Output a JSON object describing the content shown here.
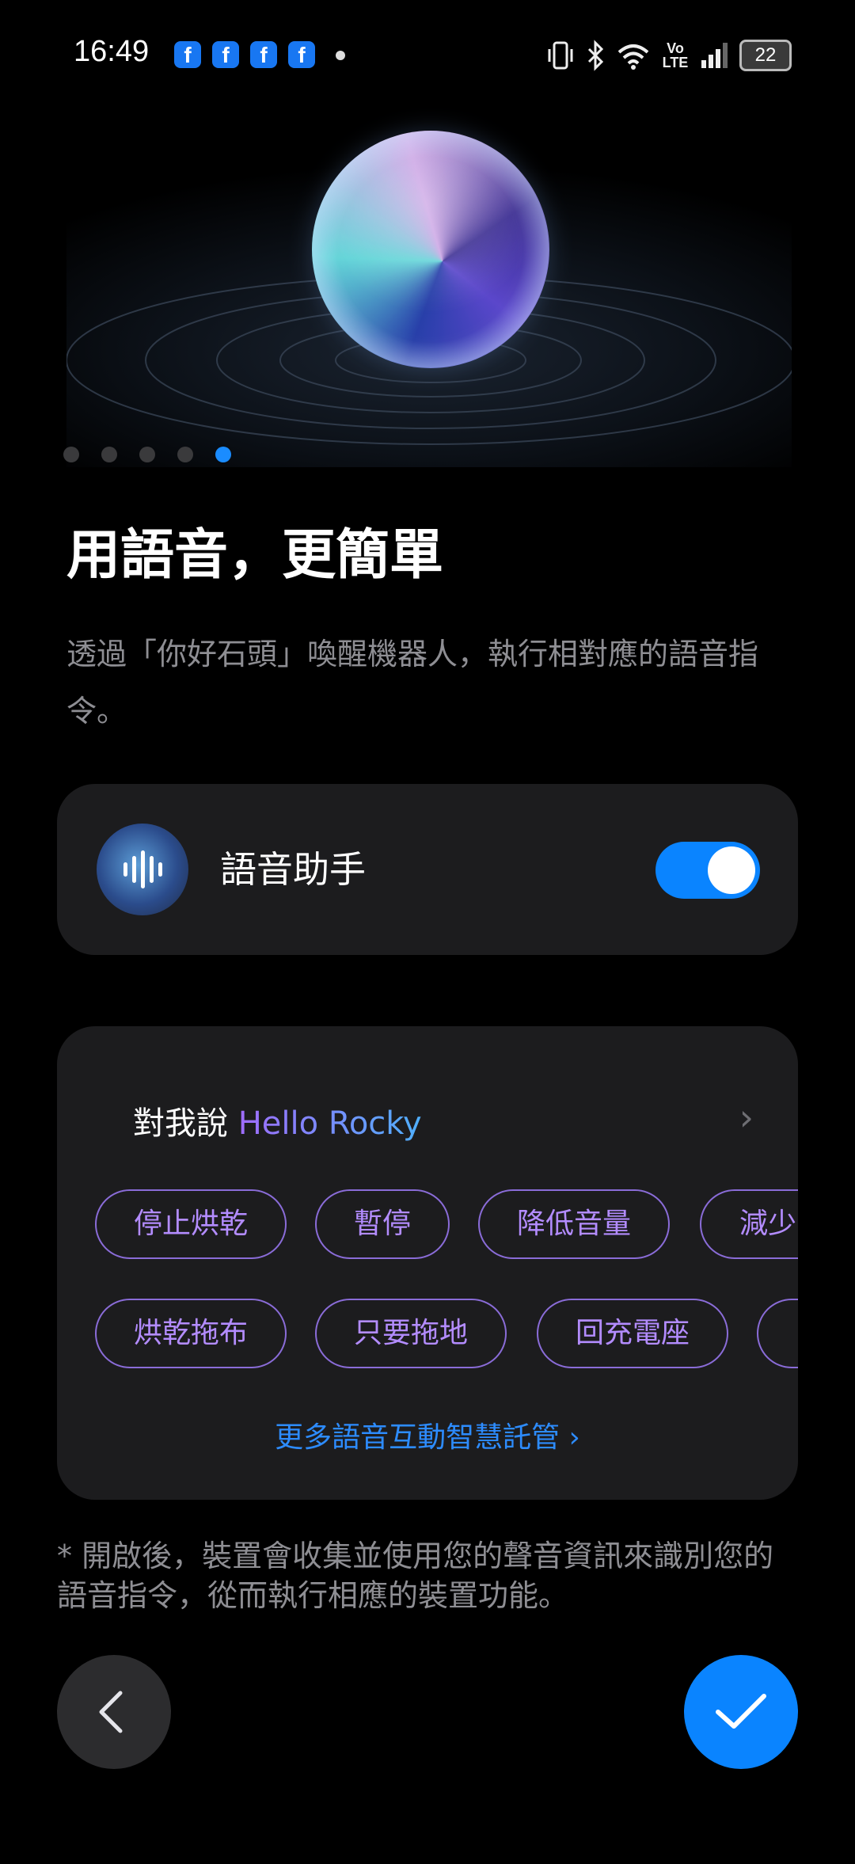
{
  "status_bar": {
    "time": "16:49",
    "notification_app": "f",
    "battery": "22",
    "icons": [
      "vibrate-icon",
      "bluetooth-icon",
      "wifi-icon",
      "volte-icon",
      "signal-icon",
      "battery-icon"
    ],
    "volte_label": "Vo LTE"
  },
  "pager": {
    "count": 5,
    "active_index": 4
  },
  "title": "用語音，更簡單",
  "description": "透過「你好石頭」喚醒機器人，執行相對應的語音指令。",
  "voice_assistant": {
    "label": "語音助手",
    "enabled": true,
    "accent": "#0a84ff"
  },
  "commands": {
    "say_prefix": "對我說 ",
    "wake_word": "Hello Rocky",
    "row1": [
      "停止烘乾",
      "暫停",
      "降低音量",
      "減少"
    ],
    "row2": [
      "烘乾拖布",
      "只要拖地",
      "回充電座",
      ""
    ],
    "more_link": "更多語音互動智慧託管 ›"
  },
  "footnote": "* 開啟後，裝置會收集並使用您的聲音資訊來識別您的語音指令，從而執行相應的裝置功能。",
  "nav": {
    "back": "chevron-left-icon",
    "confirm": "check-icon",
    "confirm_color": "#0a84ff"
  }
}
